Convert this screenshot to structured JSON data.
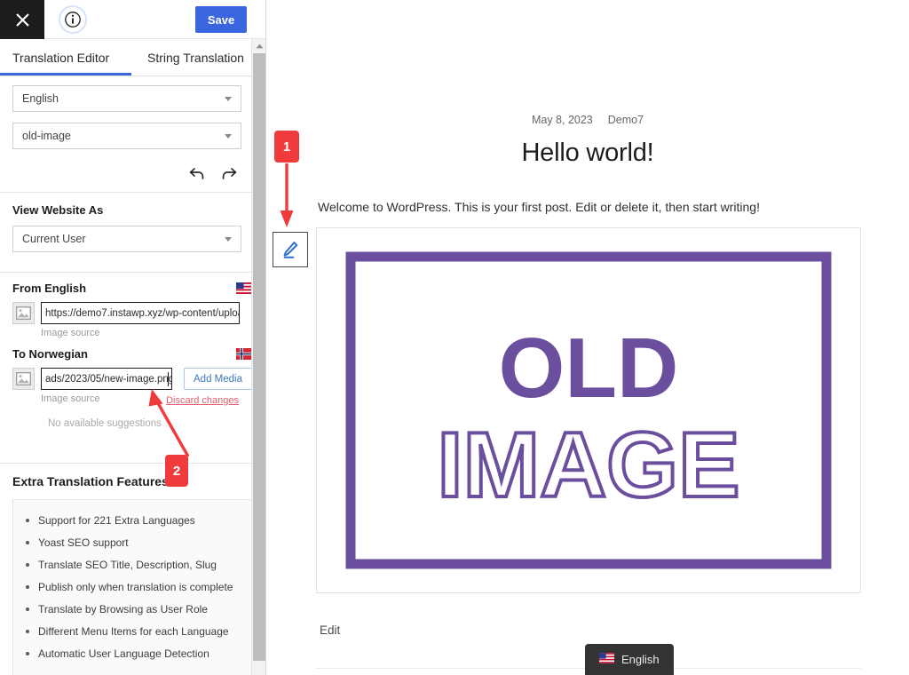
{
  "sidebar": {
    "topbar": {
      "close_icon": "close-icon",
      "info_icon": "info-icon",
      "save_label": "Save",
      "save_color": "#3a66dd"
    },
    "tabs": [
      {
        "label": "Translation Editor",
        "active": true
      },
      {
        "label": "String Translation",
        "active": false
      }
    ],
    "selects": {
      "language": "English",
      "content": "old-image"
    },
    "history": {
      "undo_icon": "undo-icon",
      "redo_icon": "redo-icon"
    },
    "view_website_as": {
      "label": "View Website As",
      "value": "Current User"
    },
    "source_pane": {
      "title": "From English",
      "flag": "us-flag-icon",
      "image_icon": "image-placeholder-icon",
      "value": "https://demo7.instawp.xyz/wp-content/uploa",
      "sub_label": "Image source"
    },
    "target_pane": {
      "title": "To Norwegian",
      "flag": "norway-flag-icon",
      "image_icon": "image-placeholder-icon",
      "value": "ads/2023/05/new-image.png",
      "sub_label": "Image source",
      "add_media_label": "Add Media",
      "discard_label": "Discard changes",
      "discard_color": "#e06070",
      "no_suggestions": "No available suggestions"
    },
    "extra_features": {
      "title": "Extra Translation Features",
      "items": [
        "Support for 221 Extra Languages",
        "Yoast SEO support",
        "Translate SEO Title, Description, Slug",
        "Publish only when translation is complete",
        "Translate by Browsing as User Role",
        "Different Menu Items for each Language",
        "Automatic User Language Detection"
      ]
    },
    "scrollbar": {
      "up_arrow_icon": "scroll-up-arrow-icon"
    }
  },
  "main": {
    "post": {
      "date": "May 8, 2023",
      "author": "Demo7",
      "title": "Hello world!",
      "body": "Welcome to WordPress. This is your first post. Edit or delete it, then start writing!",
      "edit_label": "Edit"
    },
    "featured_image": {
      "line1": "OLD",
      "line2": "IMAGE",
      "color": "#6b4f9e"
    },
    "edit_pencil": {
      "icon": "pencil-icon",
      "color": "#2f6fd0"
    },
    "language_badge": {
      "label": "English",
      "flag": "us-flag-icon",
      "background": "#333333"
    }
  },
  "annotations": {
    "marker_color": "#ef3b3b",
    "markers": [
      {
        "id": "1",
        "label": "1"
      },
      {
        "id": "2",
        "label": "2"
      }
    ]
  }
}
